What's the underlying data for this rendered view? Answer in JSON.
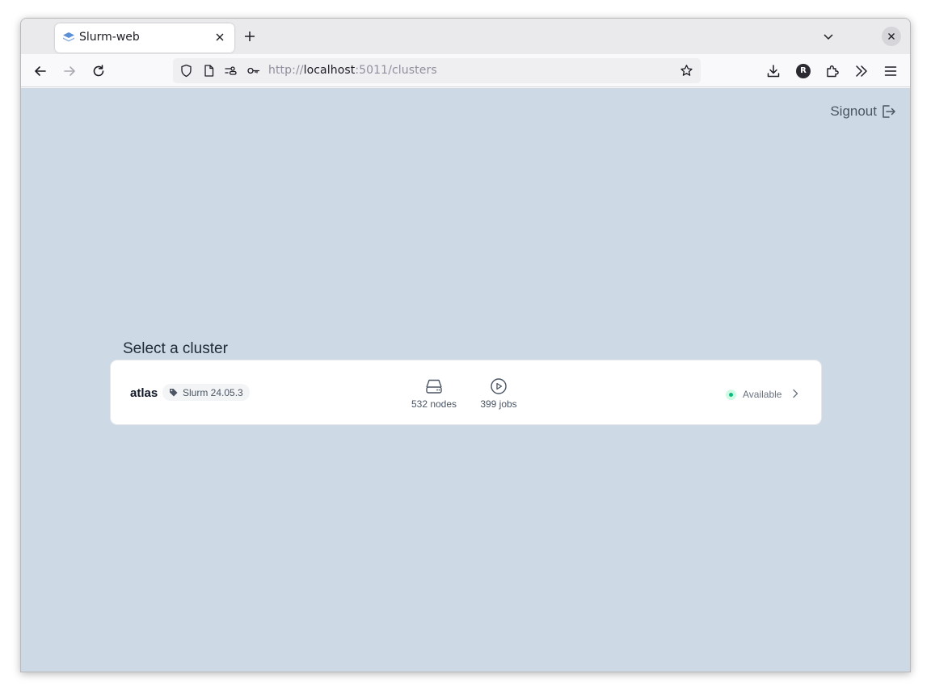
{
  "browser": {
    "tab": {
      "title": "Slurm-web"
    },
    "url": {
      "scheme": "http://",
      "host": "localhost",
      "rest": ":5011/clusters"
    },
    "profile_initial": "R"
  },
  "page": {
    "signout_label": "Signout",
    "section_title": "Select a cluster",
    "clusters": [
      {
        "name": "atlas",
        "version": "Slurm 24.05.3",
        "nodes_label": "532 nodes",
        "jobs_label": "399 jobs",
        "status": "Available"
      }
    ]
  },
  "colors": {
    "page_background": "#cddae5",
    "status_available": "#10b981"
  }
}
